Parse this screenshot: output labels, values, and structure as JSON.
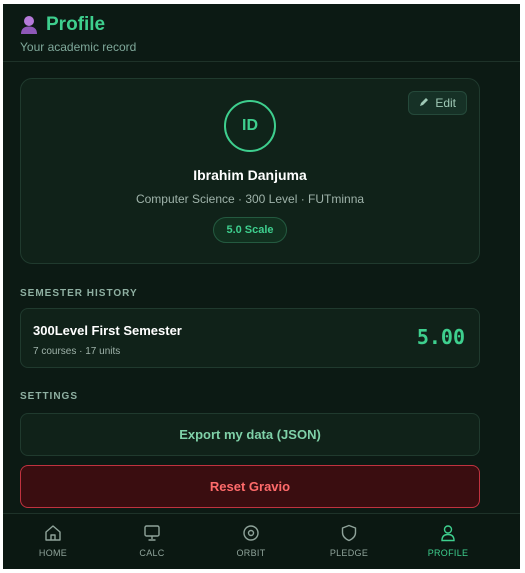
{
  "header": {
    "title": "Profile",
    "subtitle": "Your academic record",
    "icon": "person-icon"
  },
  "profile": {
    "initials": "ID",
    "name": "Ibrahim Danjuma",
    "meta": "Computer Science · 300 Level · FUTminna",
    "scale_badge": "5.0 Scale",
    "edit_label": "Edit",
    "edit_icon": "pencil-icon"
  },
  "semester_history": {
    "label": "SEMESTER HISTORY",
    "items": [
      {
        "name": "300Level First Semester",
        "detail": "7 courses · 17 units",
        "gpa": "5.00"
      }
    ]
  },
  "settings": {
    "label": "SETTINGS",
    "export_label": "Export my data (JSON)",
    "reset_label": "Reset Gravio"
  },
  "nav": {
    "active": "PROFILE",
    "items": [
      {
        "label": "HOME",
        "icon": "home-icon"
      },
      {
        "label": "CALC",
        "icon": "monitor-icon"
      },
      {
        "label": "ORBIT",
        "icon": "orbit-icon"
      },
      {
        "label": "PLEDGE",
        "icon": "shield-icon"
      },
      {
        "label": "PROFILE",
        "icon": "user-icon"
      }
    ]
  },
  "colors": {
    "background": "#0c1a14",
    "accent": "#3ecf8e",
    "danger": "#ff6b6b",
    "danger_bg": "#3a0d10"
  }
}
